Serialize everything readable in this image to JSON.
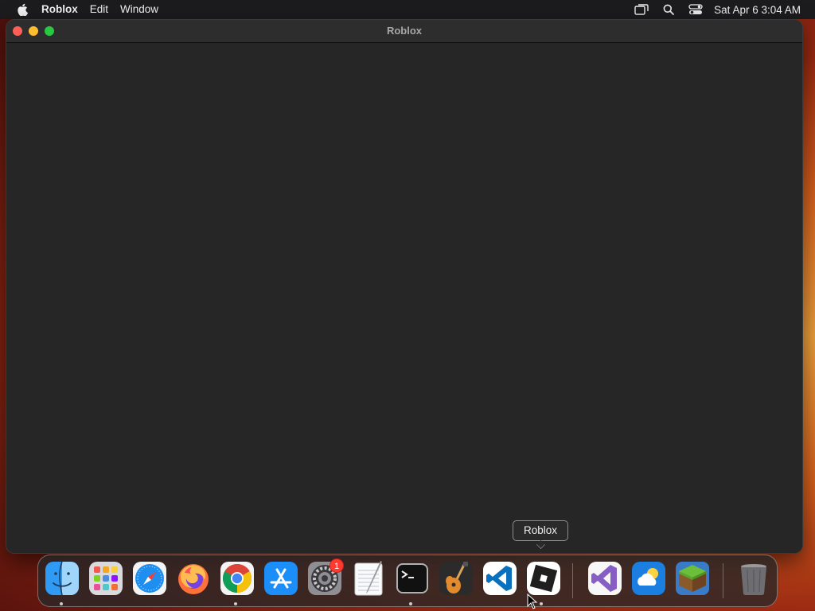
{
  "menubar": {
    "app_name": "Roblox",
    "menus": [
      "Edit",
      "Window"
    ],
    "clock": "Sat Apr 6  3:04 AM",
    "status_icons": [
      "screen-mirroring-icon",
      "search-icon",
      "control-center-icon"
    ]
  },
  "window": {
    "title": "Roblox"
  },
  "tooltip": {
    "label": "Roblox"
  },
  "dock": {
    "apps": [
      {
        "name": "Finder",
        "icon": "finder-icon",
        "running": true
      },
      {
        "name": "Launchpad",
        "icon": "launchpad-icon",
        "running": false
      },
      {
        "name": "Safari",
        "icon": "safari-icon",
        "running": false
      },
      {
        "name": "Firefox",
        "icon": "firefox-icon",
        "running": false
      },
      {
        "name": "Google Chrome",
        "icon": "chrome-icon",
        "running": true
      },
      {
        "name": "App Store",
        "icon": "app-store-icon",
        "running": false
      },
      {
        "name": "System Settings",
        "icon": "system-settings-icon",
        "running": false,
        "badge": "1"
      },
      {
        "name": "TextEdit",
        "icon": "textedit-icon",
        "running": false
      },
      {
        "name": "Terminal",
        "icon": "terminal-icon",
        "running": true
      },
      {
        "name": "GarageBand",
        "icon": "garageband-icon",
        "running": false
      },
      {
        "name": "Visual Studio Code",
        "icon": "vscode-icon",
        "running": false
      },
      {
        "name": "Roblox",
        "icon": "roblox-icon",
        "running": true
      },
      {
        "name": "Visual Studio",
        "icon": "visual-studio-icon",
        "running": false
      },
      {
        "name": "Weather",
        "icon": "weather-icon",
        "running": false
      },
      {
        "name": "Minecraft",
        "icon": "minecraft-icon",
        "running": false
      },
      {
        "name": "Trash",
        "icon": "trash-icon",
        "running": false
      }
    ]
  },
  "colors": {
    "close": "#ff5f57",
    "minimize": "#febc2e",
    "maximize": "#28c840",
    "badge": "#ff3b30",
    "window_bg": "#262626"
  }
}
